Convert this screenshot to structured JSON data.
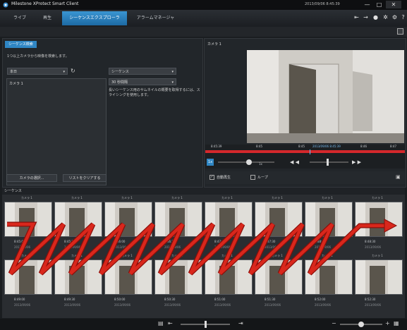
{
  "app": {
    "title": "Milestone XProtect Smart Client",
    "clock": "2013/09/06 8:45:39"
  },
  "tabs": [
    {
      "label": "ライブ"
    },
    {
      "label": "再生"
    },
    {
      "label": "シーケンスエクスプローラ"
    },
    {
      "label": "アラームマネージャ"
    }
  ],
  "search_panel": {
    "tab_label": "シーケンス検索",
    "instruction": "1つ以上カメラから映像を検索します。",
    "period_select": "本日",
    "type_select": "シーケンス",
    "interval_select": "30 秒間隔",
    "camera_item": "カメラ 1",
    "help_text": "長いシーケンス用のサムネイルの概要を取得するには、スライシングを使用します。",
    "select_camera_button": "カメラの選択...",
    "clear_list_button": "リストをクリアする"
  },
  "preview_panel": {
    "camera_name": "カメラ 1",
    "ticks": [
      "8:45:39",
      "8:45",
      "8:45",
      "2013/09/06 8:45:39",
      "8:46",
      "8:47"
    ],
    "speed_label": "1x",
    "speed_value": "1x",
    "auto_play_label": "自動再生",
    "loop_label": "ループ"
  },
  "sequence_section": {
    "header": "シーケンス"
  },
  "thumbnails": [
    {
      "label": "カメラ 1",
      "time": "8:45:00",
      "date": "2013/09/06"
    },
    {
      "label": "カメラ 1",
      "time": "8:45:30",
      "date": "2013/09/06"
    },
    {
      "label": "カメラ 1",
      "time": "8:46:00",
      "date": "2013/09/06"
    },
    {
      "label": "カメラ 1",
      "time": "8:46:30",
      "date": "2013/09/06"
    },
    {
      "label": "カメラ 1",
      "time": "8:47:00",
      "date": "2013/09/06"
    },
    {
      "label": "カメラ 1",
      "time": "8:47:30",
      "date": "2013/09/06"
    },
    {
      "label": "カメラ 1",
      "time": "8:48:00",
      "date": "2013/09/06"
    },
    {
      "label": "カメラ 1",
      "time": "8:48:30",
      "date": "2013/09/06"
    },
    {
      "label": "カメラ 1",
      "time": "8:49:00",
      "date": "2013/09/06"
    },
    {
      "label": "カメラ 1",
      "time": "8:49:30",
      "date": "2013/09/06"
    },
    {
      "label": "カメラ 1",
      "time": "8:50:00",
      "date": "2013/09/06"
    },
    {
      "label": "カメラ 1",
      "time": "8:50:30",
      "date": "2013/09/06"
    },
    {
      "label": "カメラ 1",
      "time": "8:51:00",
      "date": "2013/09/06"
    },
    {
      "label": "カメラ 1",
      "time": "8:51:30",
      "date": "2013/09/06"
    },
    {
      "label": "カメラ 1",
      "time": "8:52:00",
      "date": "2013/09/06"
    },
    {
      "label": "カメラ 1",
      "time": "8:52:30",
      "date": "2013/09/06"
    }
  ],
  "colors": {
    "accent": "#2f86c4",
    "timeline_red": "#d4282c",
    "overlay_arrow": "#d9271c"
  },
  "icons": [
    "milestone-logo-icon",
    "minimize-icon",
    "maximize-icon",
    "close-icon",
    "refresh-icon",
    "play-icon",
    "fast-forward-icon",
    "rewind-icon",
    "settings-icon",
    "grid-icon"
  ]
}
